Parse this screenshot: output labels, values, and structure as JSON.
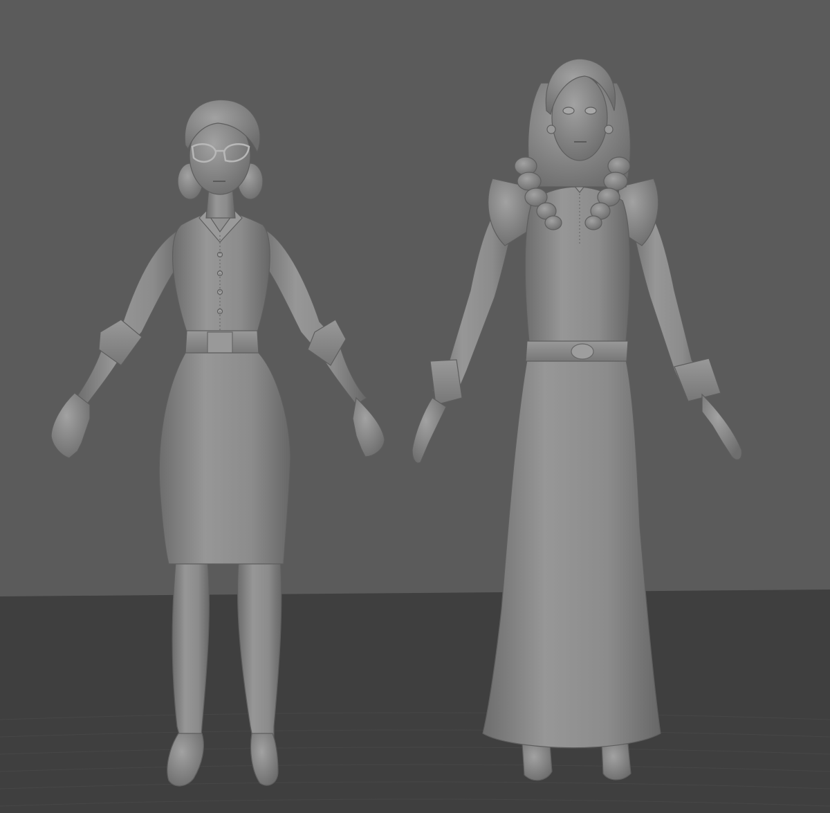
{
  "viewport": {
    "background_color": "#5b5b5b",
    "floor_color": "#3f3f3f",
    "floor_line_color": "#474747",
    "clay_color": "#8e8e8e"
  },
  "models": [
    {
      "name": "woman-short-skirt-glasses"
    },
    {
      "name": "woman-long-dress-curls"
    }
  ]
}
